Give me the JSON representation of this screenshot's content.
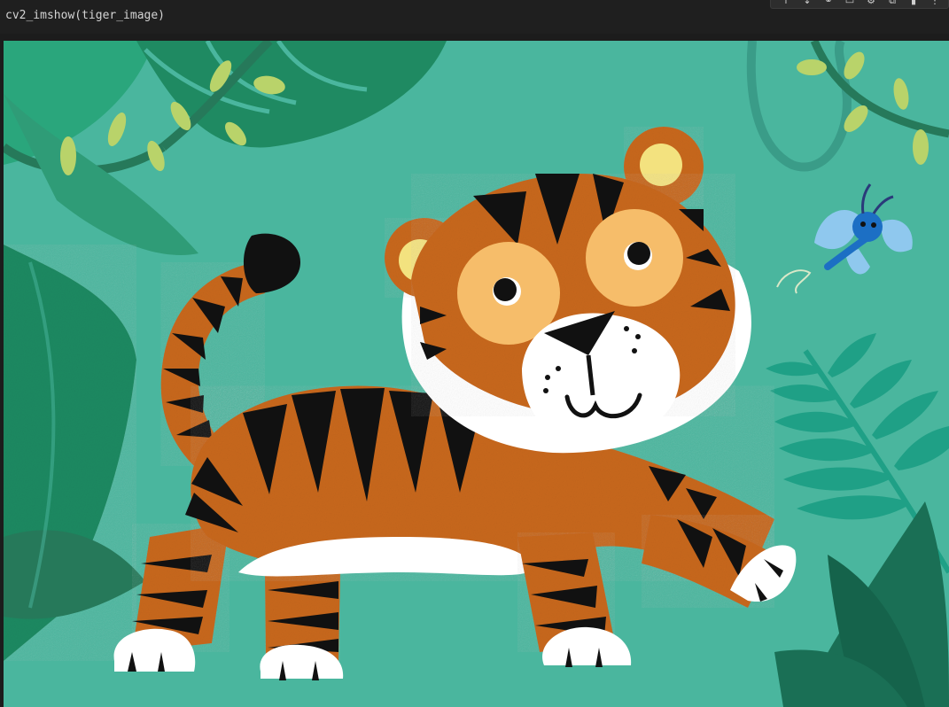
{
  "cell": {
    "code": "cv2_imshow(tiger_image)"
  },
  "toolbar": {
    "icons": [
      {
        "name": "move-up-icon",
        "glyph": "↑"
      },
      {
        "name": "move-down-icon",
        "glyph": "↓"
      },
      {
        "name": "link-icon",
        "glyph": "⚭"
      },
      {
        "name": "comment-icon",
        "glyph": "▭"
      },
      {
        "name": "settings-icon",
        "glyph": "⚙"
      },
      {
        "name": "mirror-icon",
        "glyph": "⧉"
      },
      {
        "name": "delete-icon",
        "glyph": "▮"
      },
      {
        "name": "more-icon",
        "glyph": "⋮"
      }
    ]
  },
  "output": {
    "image_description": "cartoon tiger in jungle"
  },
  "colors": {
    "background": "#4ab69e",
    "tiger_orange": "#c8681f",
    "stripe": "#111111",
    "face_patch": "#f6bd6a",
    "ear_inner": "#f3e27f",
    "leaf_dark": "#1f8a62",
    "leaf_mid": "#2aa67c",
    "butterfly": "#8fc8ee"
  }
}
